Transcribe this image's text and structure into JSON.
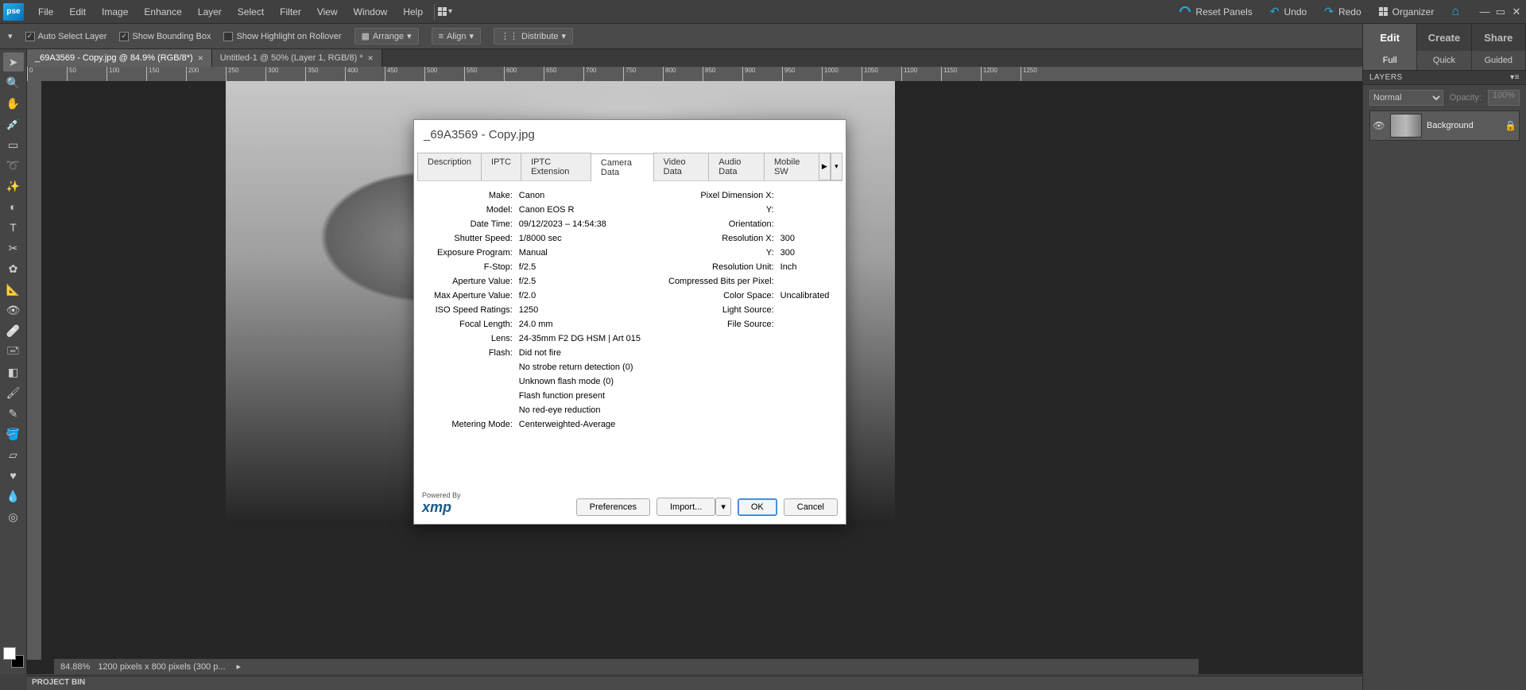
{
  "app_logo": "pse",
  "menu": [
    "File",
    "Edit",
    "Image",
    "Enhance",
    "Layer",
    "Select",
    "Filter",
    "View",
    "Window",
    "Help"
  ],
  "top_right": {
    "reset": "Reset Panels",
    "undo": "Undo",
    "redo": "Redo",
    "organizer": "Organizer"
  },
  "options": {
    "auto_select": "Auto Select Layer",
    "show_bbox": "Show Bounding Box",
    "show_highlight": "Show Highlight on Rollover",
    "arrange": "Arrange",
    "align": "Align",
    "distribute": "Distribute"
  },
  "mode_tabs": [
    "Edit",
    "Create",
    "Share"
  ],
  "sub_tabs": [
    "Full",
    "Quick",
    "Guided"
  ],
  "layers_panel": {
    "title": "LAYERS",
    "blend": "Normal",
    "opacity_label": "Opacity:",
    "opacity_value": "100%",
    "layer_name": "Background"
  },
  "doc_tabs": [
    {
      "label": "_69A3569 - Copy.jpg @ 84.9% (RGB/8*)",
      "active": true
    },
    {
      "label": "Untitled-1 @ 50% (Layer 1, RGB/8) *",
      "active": false
    }
  ],
  "ruler_marks": [
    "0",
    "50",
    "100",
    "150",
    "200",
    "250",
    "300",
    "350",
    "400",
    "450",
    "500",
    "550",
    "600",
    "650",
    "700",
    "750",
    "800",
    "850",
    "900",
    "950",
    "1000",
    "1050",
    "1100",
    "1150",
    "1200",
    "1250"
  ],
  "status": {
    "zoom": "84.88%",
    "dims": "1200 pixels x 800 pixels (300 p...",
    "project_bin": "PROJECT BIN"
  },
  "dialog": {
    "title": "_69A3569 - Copy.jpg",
    "tabs": [
      "Description",
      "IPTC",
      "IPTC Extension",
      "Camera Data",
      "Video Data",
      "Audio Data",
      "Mobile SW"
    ],
    "active_tab": "Camera Data",
    "left": [
      {
        "l": "Make:",
        "v": "Canon"
      },
      {
        "l": "Model:",
        "v": "Canon EOS R"
      },
      {
        "l": "Date Time:",
        "v": "09/12/2023 – 14:54:38"
      },
      {
        "l": "Shutter Speed:",
        "v": "1/8000 sec"
      },
      {
        "l": "Exposure Program:",
        "v": "Manual"
      },
      {
        "l": "F-Stop:",
        "v": "f/2.5"
      },
      {
        "l": "Aperture Value:",
        "v": "f/2.5"
      },
      {
        "l": "Max Aperture Value:",
        "v": "f/2.0"
      },
      {
        "l": "ISO Speed Ratings:",
        "v": "1250"
      },
      {
        "l": "Focal Length:",
        "v": "24.0 mm"
      },
      {
        "l": "Lens:",
        "v": "24-35mm F2 DG HSM | Art 015"
      },
      {
        "l": "Flash:",
        "v": "Did not fire"
      },
      {
        "l": "",
        "v": "No strobe return detection (0)"
      },
      {
        "l": "",
        "v": "Unknown flash mode (0)"
      },
      {
        "l": "",
        "v": "Flash function present"
      },
      {
        "l": "",
        "v": "No red-eye reduction"
      },
      {
        "l": "Metering Mode:",
        "v": "Centerweighted-Average"
      }
    ],
    "right": [
      {
        "l": "Pixel Dimension X:",
        "v": ""
      },
      {
        "l": "Y:",
        "v": ""
      },
      {
        "l": "Orientation:",
        "v": ""
      },
      {
        "l": "Resolution X:",
        "v": "300"
      },
      {
        "l": "Y:",
        "v": "300"
      },
      {
        "l": "Resolution Unit:",
        "v": "Inch"
      },
      {
        "l": "Compressed Bits per Pixel:",
        "v": ""
      },
      {
        "l": "Color Space:",
        "v": "Uncalibrated"
      },
      {
        "l": "Light Source:",
        "v": ""
      },
      {
        "l": "File Source:",
        "v": ""
      }
    ],
    "xmp_small": "Powered By",
    "xmp": "xmp",
    "buttons": {
      "preferences": "Preferences",
      "import": "Import...",
      "ok": "OK",
      "cancel": "Cancel"
    }
  }
}
